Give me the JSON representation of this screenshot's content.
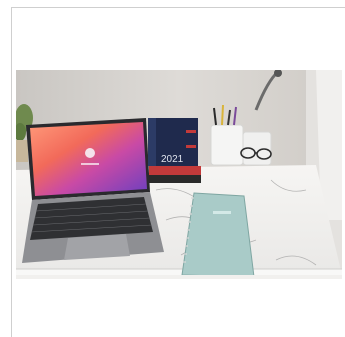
{
  "image": {
    "alt": "",
    "colors": {
      "wall": "#d9d6d2",
      "desk": "#f2f1ef",
      "marble_vein": "#9a9a9a",
      "laptop_body": "#8e8f93",
      "screen_orange": "#f27a3a",
      "screen_purple": "#7b3fb8",
      "notebook": "#a9cbc8",
      "book_navy": "#1f2a4d",
      "book_red": "#c33a3a"
    },
    "book_spine_text": "2021"
  }
}
